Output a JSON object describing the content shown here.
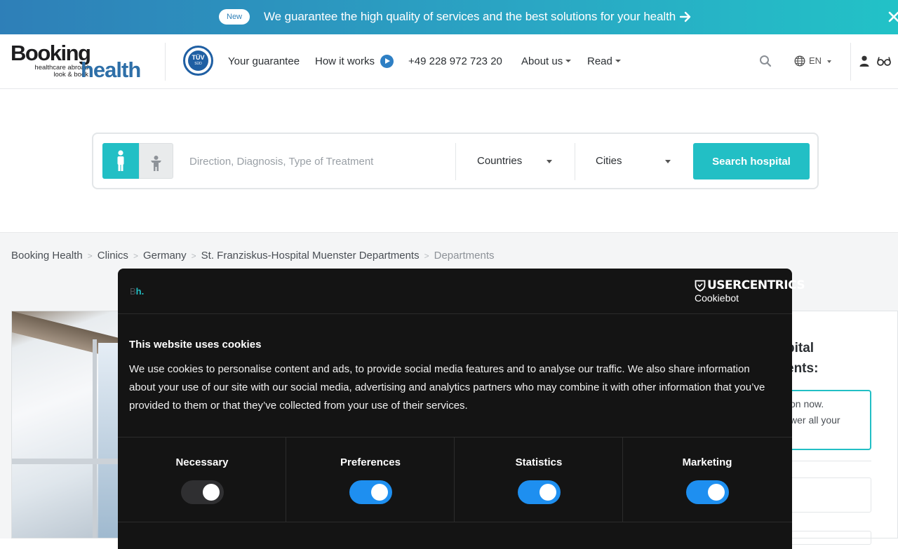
{
  "banner": {
    "badge": "New",
    "text": "We guarantee the high quality of services and the best solutions for your health"
  },
  "header": {
    "logo": {
      "line1": "Booking",
      "line2": "healthcare abroad look & book",
      "line3": "health"
    },
    "tuv": {
      "label": "TÜV",
      "sub": "SÜD"
    },
    "nav": {
      "guarantee": "Your guarantee",
      "how_it_works": "How it works",
      "phone": "+49 228 972 723 20",
      "about": "About us",
      "read": "Read"
    },
    "language": "EN"
  },
  "search": {
    "placeholder": "Direction, Diagnosis, Type of Treatment",
    "countries": "Countries",
    "cities": "Cities",
    "button": "Search hospital"
  },
  "breadcrumb": [
    "Booking Health",
    "Clinics",
    "Germany",
    "St. Franziskus-Hospital Muenster Departments"
  ],
  "breadcrumb_current": "Departments",
  "right_card": {
    "title_line1": "pital",
    "title_line2": "ents:",
    "box_line1": "on now.",
    "box_line2": "wer all your"
  },
  "cookie": {
    "brand": {
      "prefix": "B",
      "accent": "h."
    },
    "provider": {
      "name": "USERCENTRICS",
      "product": "Cookiebot"
    },
    "title": "This website uses cookies",
    "body": "We use cookies to personalise content and ads, to provide social media features and to analyse our traffic. We also share information about your use of our site with our social media, advertising and analytics partners who may combine it with other information that you’ve provided to them or that they’ve collected from your use of their services.",
    "categories": [
      {
        "label": "Necessary",
        "enabled": true,
        "locked": true
      },
      {
        "label": "Preferences",
        "enabled": true
      },
      {
        "label": "Statistics",
        "enabled": true
      },
      {
        "label": "Marketing",
        "enabled": true
      }
    ]
  },
  "colors": {
    "accent": "#22bfc5",
    "brand_blue": "#2e6fa8",
    "toggle_on": "#1e8ff0",
    "modal_bg": "#141414"
  }
}
